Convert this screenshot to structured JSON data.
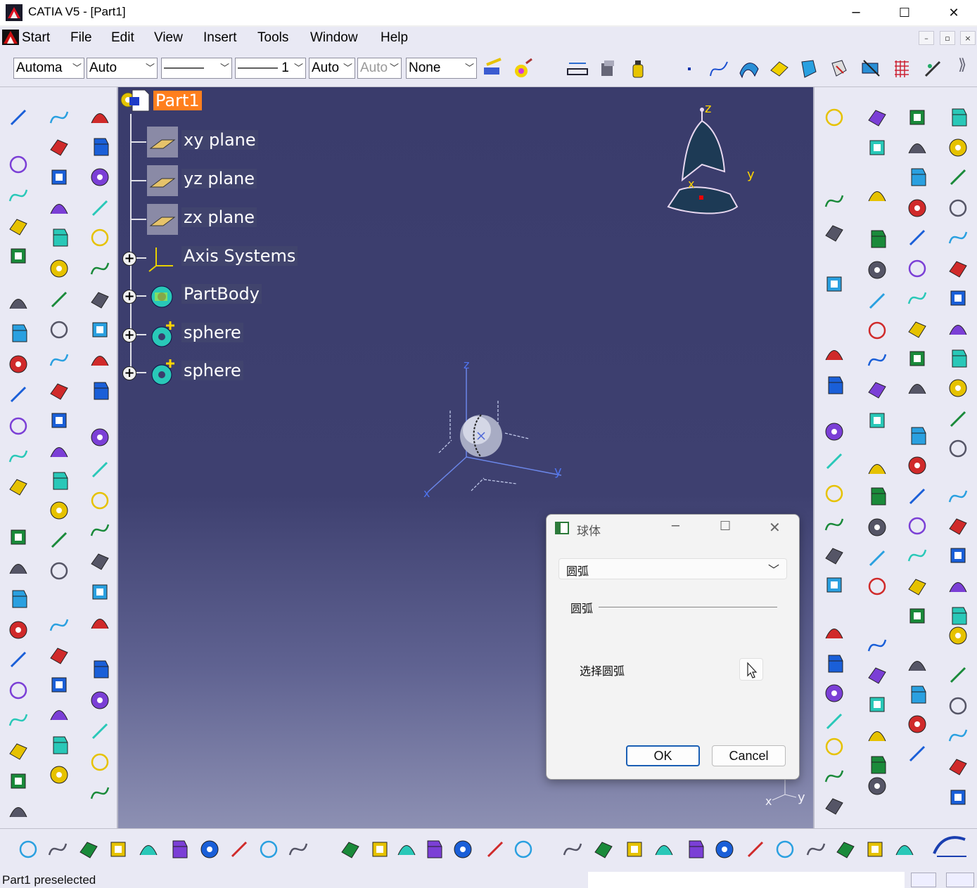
{
  "window": {
    "title": "CATIA V5 - [Part1]",
    "minimize": "─",
    "maximize": "☐",
    "close": "✕"
  },
  "menu": {
    "items": [
      "Start",
      "File",
      "Edit",
      "View",
      "Insert",
      "Tools",
      "Window",
      "Help"
    ],
    "mdi": [
      "–",
      "▫",
      "×"
    ]
  },
  "toolbar_top": {
    "combos": [
      {
        "value": "Automa"
      },
      {
        "value": "Auto"
      },
      {
        "value": "———"
      },
      {
        "value": "——— 1"
      },
      {
        "value": "Auto"
      },
      {
        "value": "Auto"
      },
      {
        "value": "None"
      }
    ]
  },
  "tree": {
    "root": "Part1",
    "items": [
      {
        "label": "xy plane",
        "icon": "plane-icon",
        "expandable": false
      },
      {
        "label": "yz plane",
        "icon": "plane-icon",
        "expandable": false
      },
      {
        "label": "zx plane",
        "icon": "plane-icon",
        "expandable": false
      },
      {
        "label": "Axis Systems",
        "icon": "axis-system-icon",
        "expandable": true
      },
      {
        "label": "PartBody",
        "icon": "partbody-icon",
        "expandable": true
      },
      {
        "label": "sphere",
        "icon": "geometrical-set-icon",
        "expandable": true
      },
      {
        "label": "sphere",
        "icon": "geometrical-set-icon",
        "expandable": true
      }
    ]
  },
  "compass": {
    "z": "z",
    "y": "y",
    "x": "x"
  },
  "model_axes": {
    "z": "z",
    "y": "y",
    "x": "x"
  },
  "corner_axes": {
    "y": "y",
    "x": "x"
  },
  "dialog": {
    "title": "球体",
    "dropdown_value": "圆弧",
    "group_label": "圆弧",
    "select_label": "选择圆弧",
    "ok": "OK",
    "cancel": "Cancel"
  },
  "status": {
    "text": "Part1 preselected"
  },
  "colors": {
    "accent_tree_selected": "#ff7f1e",
    "viewport_top": "#3a3c6c",
    "viewport_bottom": "#8d90b3",
    "panel": "#e9e9f4"
  }
}
